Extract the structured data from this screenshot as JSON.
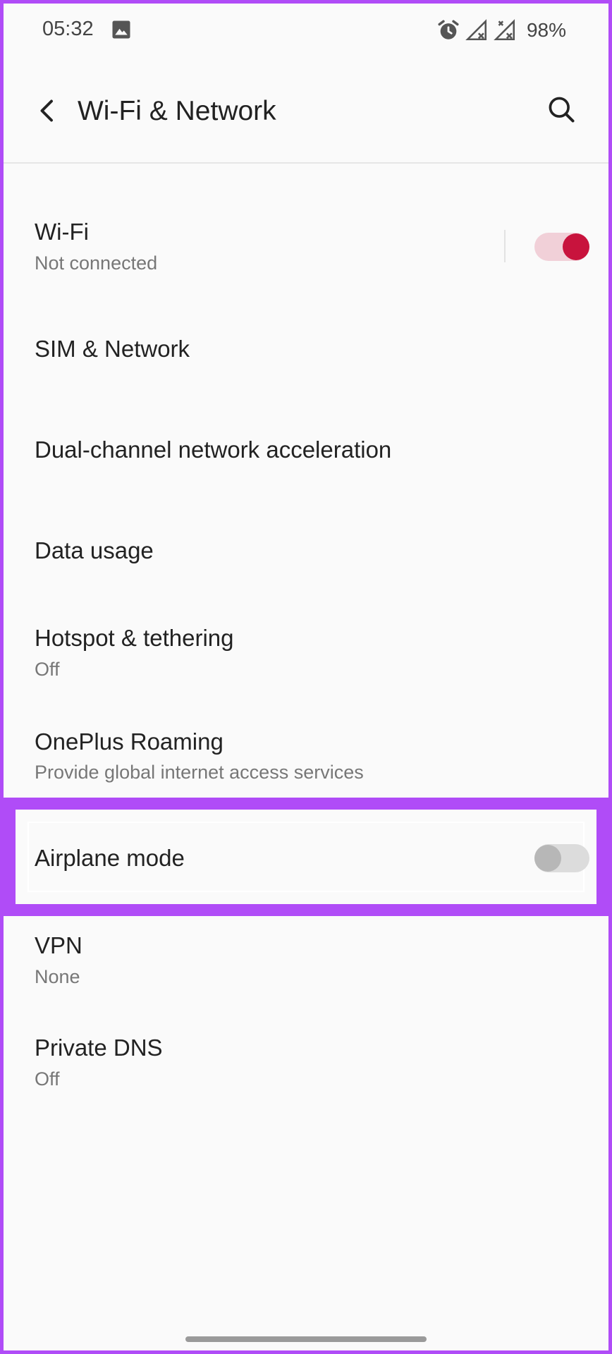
{
  "status_bar": {
    "time": "05:32",
    "gallery_icon": "image-icon",
    "alarm_icon": "alarm-icon",
    "signal_icons": [
      "no-signal-icon",
      "no-signal-icon"
    ],
    "battery": "98%"
  },
  "app_bar": {
    "title": "Wi-Fi & Network",
    "back_icon": "back-arrow-icon",
    "search_icon": "search-icon"
  },
  "items": [
    {
      "title": "Wi-Fi",
      "subtitle": "Not connected",
      "toggle": "on"
    },
    {
      "title": "SIM & Network"
    },
    {
      "title": "Dual-channel network acceleration"
    },
    {
      "title": "Data usage"
    },
    {
      "title": "Hotspot & tethering",
      "subtitle": "Off"
    },
    {
      "title": "OnePlus Roaming",
      "subtitle": "Provide global internet access services"
    },
    {
      "title": "Airplane mode",
      "toggle": "off"
    },
    {
      "title": "VPN",
      "subtitle": "None"
    },
    {
      "title": "Private DNS",
      "subtitle": "Off"
    }
  ],
  "colors": {
    "accent": "#c8133d",
    "highlight": "#b04cf7"
  }
}
